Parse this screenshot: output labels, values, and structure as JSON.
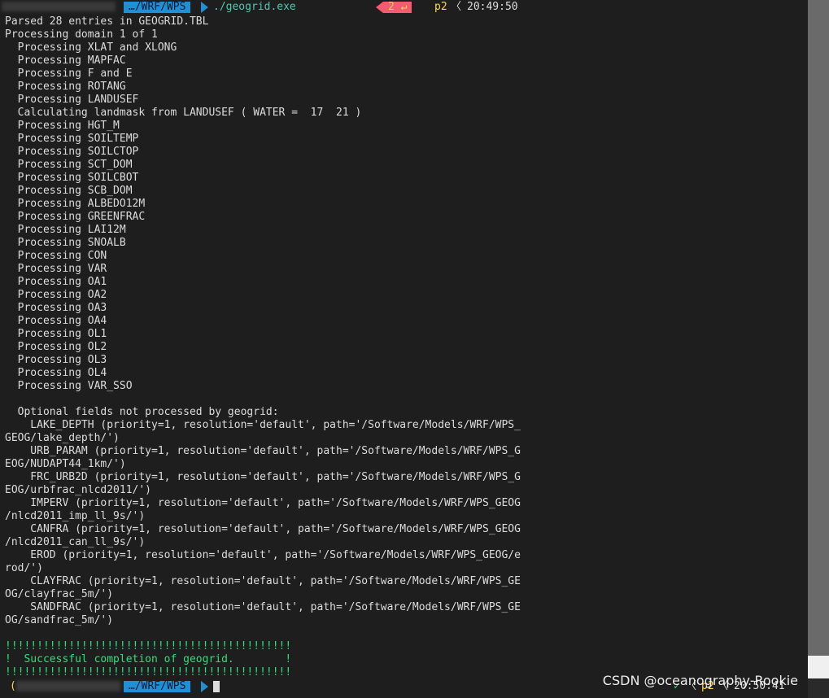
{
  "prompt_top": {
    "path": "…/WRF/WPS",
    "command": "./geogrid.exe",
    "exit_code": "2 ↵",
    "job": "p2",
    "chevron": "〈",
    "time": "20:49:50"
  },
  "output_lines": [
    "Parsed 28 entries in GEOGRID.TBL",
    "Processing domain 1 of 1",
    "  Processing XLAT and XLONG",
    "  Processing MAPFAC",
    "  Processing F and E",
    "  Processing ROTANG",
    "  Processing LANDUSEF",
    "  Calculating landmask from LANDUSEF ( WATER =  17  21 )",
    "  Processing HGT_M",
    "  Processing SOILTEMP",
    "  Processing SOILCTOP",
    "  Processing SCT_DOM",
    "  Processing SOILCBOT",
    "  Processing SCB_DOM",
    "  Processing ALBEDO12M",
    "  Processing GREENFRAC",
    "  Processing LAI12M",
    "  Processing SNOALB",
    "  Processing CON",
    "  Processing VAR",
    "  Processing OA1",
    "  Processing OA2",
    "  Processing OA3",
    "  Processing OA4",
    "  Processing OL1",
    "  Processing OL2",
    "  Processing OL3",
    "  Processing OL4",
    "  Processing VAR_SSO",
    "",
    "  Optional fields not processed by geogrid:",
    "    LAKE_DEPTH (priority=1, resolution='default', path='/Software/Models/WRF/WPS_",
    "GEOG/lake_depth/')",
    "    URB_PARAM (priority=1, resolution='default', path='/Software/Models/WRF/WPS_G",
    "EOG/NUDAPT44_1km/')",
    "    FRC_URB2D (priority=1, resolution='default', path='/Software/Models/WRF/WPS_G",
    "EOG/urbfrac_nlcd2011/')",
    "    IMPERV (priority=1, resolution='default', path='/Software/Models/WRF/WPS_GEOG",
    "/nlcd2011_imp_ll_9s/')",
    "    CANFRA (priority=1, resolution='default', path='/Software/Models/WRF/WPS_GEOG",
    "/nlcd2011_can_ll_9s/')",
    "    EROD (priority=1, resolution='default', path='/Software/Models/WRF/WPS_GEOG/e",
    "rod/')",
    "    CLAYFRAC (priority=1, resolution='default', path='/Software/Models/WRF/WPS_GE",
    "OG/clayfrac_5m/')",
    "    SANDFRAC (priority=1, resolution='default', path='/Software/Models/WRF/WPS_GE",
    "OG/sandfrac_5m/')",
    ""
  ],
  "success_lines": [
    "!!!!!!!!!!!!!!!!!!!!!!!!!!!!!!!!!!!!!!!!!!!!!",
    "!  Successful completion of geogrid.        !",
    "!!!!!!!!!!!!!!!!!!!!!!!!!!!!!!!!!!!!!!!!!!!!!"
  ],
  "prompt_bottom": {
    "paren": "(",
    "path": "…/WRF/WPS",
    "check": "✓",
    "chevron": "〈",
    "job": "p2",
    "chevron2": "〈",
    "time": "20:50:41"
  },
  "watermark": "CSDN @oceanography-Rookie",
  "colors": {
    "background": "#1e1e1e",
    "text": "#dcdcdc",
    "path_segment": "#1f8fd6",
    "error_segment": "#f25c6e",
    "command": "#4ec9b0",
    "success": "#2fe07a",
    "time_yellow": "#ffd84d"
  }
}
